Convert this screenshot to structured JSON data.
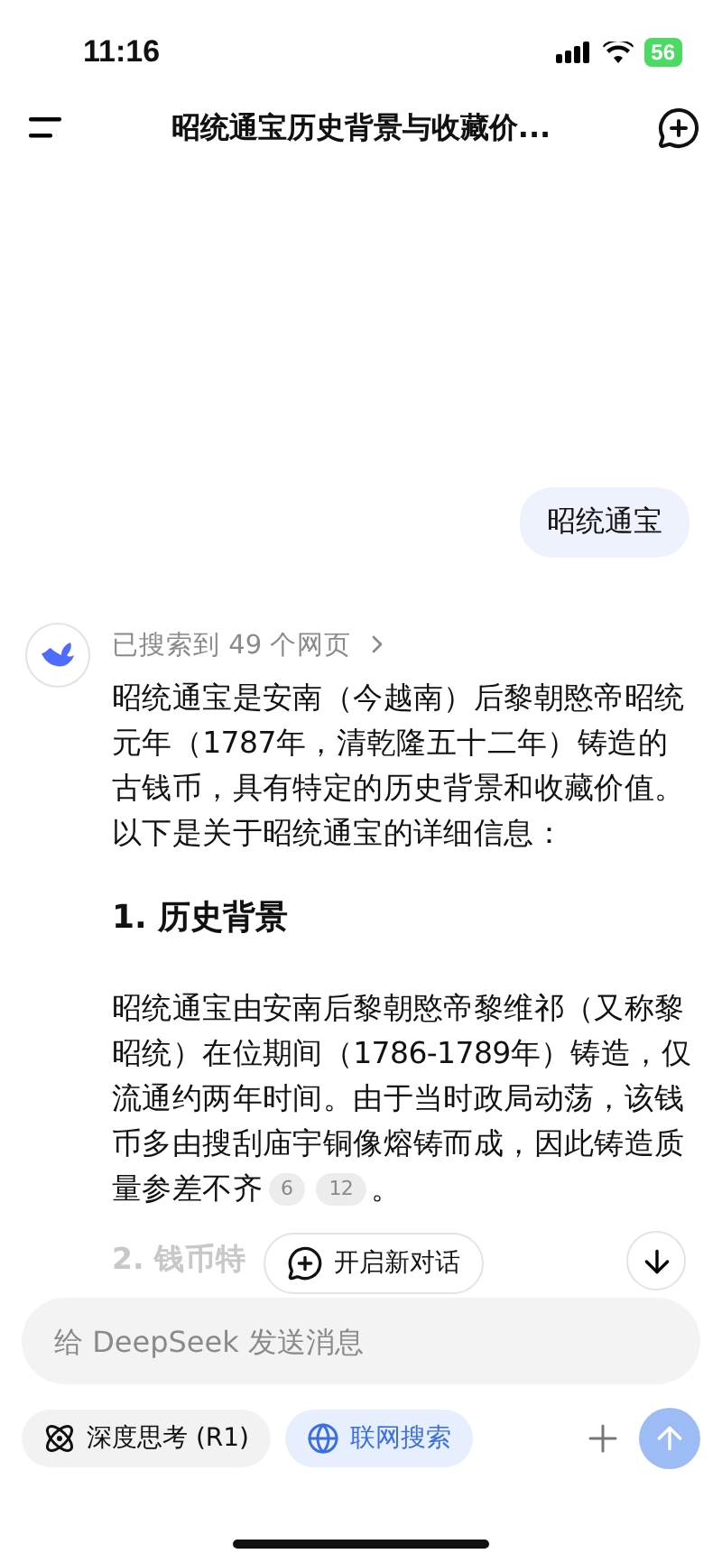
{
  "status_bar": {
    "time": "11:16",
    "battery": "56"
  },
  "header": {
    "title": "昭统通宝历史背景与收藏价..."
  },
  "messages": [
    {
      "kind": "user",
      "text": "昭统通宝"
    },
    {
      "kind": "assistant",
      "search_summary": "已搜索到 49 个网页",
      "blocks": [
        {
          "kind": "paragraph",
          "text": "昭统通宝是安南（今越南）后黎朝愍帝昭统元年（1787年，清乾隆五十二年）铸造的古钱币，具有特定的历史背景和收藏价值。以下是关于昭统通宝的详细信息："
        },
        {
          "kind": "heading",
          "text": "1. 历史背景"
        },
        {
          "kind": "paragraph",
          "text": "昭统通宝由安南后黎朝愍帝黎维祁（又称黎昭统）在位期间（1786-1789年）铸造，仅流通约两年时间。由于当时政局动荡，该钱币多由搜刮庙宇铜像熔铸而成，因此铸造质量参差不齐",
          "citations": [
            "6",
            "12"
          ],
          "end": "。"
        },
        {
          "kind": "faded_heading",
          "text": "2. 钱币特"
        }
      ]
    }
  ],
  "new_chat_button": "开启新对话",
  "composer": {
    "placeholder": "给 DeepSeek 发送消息"
  },
  "toggles": [
    {
      "kind": "think",
      "label": "深度思考 (R1)",
      "selected": false
    },
    {
      "kind": "search",
      "label": "联网搜索",
      "selected": true
    }
  ],
  "send_button": {
    "disabled": true
  }
}
